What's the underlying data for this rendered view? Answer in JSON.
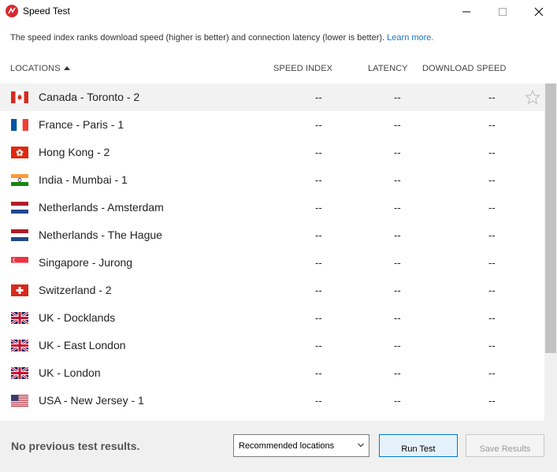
{
  "window": {
    "title": "Speed Test"
  },
  "info": {
    "text": "The speed index ranks download speed (higher is better) and connection latency (lower is better).",
    "link": "Learn more."
  },
  "columns": {
    "locations": "LOCATIONS",
    "speed_index": "SPEED INDEX",
    "latency": "LATENCY",
    "download_speed": "DOWNLOAD SPEED"
  },
  "rows": [
    {
      "location": "Canada - Toronto - 2",
      "flag": "canada-flag-icon",
      "speed_index": "--",
      "latency": "--",
      "download_speed": "--",
      "selected": true
    },
    {
      "location": "France - Paris - 1",
      "flag": "france-flag-icon",
      "speed_index": "--",
      "latency": "--",
      "download_speed": "--"
    },
    {
      "location": "Hong Kong - 2",
      "flag": "hong-kong-flag-icon",
      "speed_index": "--",
      "latency": "--",
      "download_speed": "--"
    },
    {
      "location": "India - Mumbai - 1",
      "flag": "india-flag-icon",
      "speed_index": "--",
      "latency": "--",
      "download_speed": "--"
    },
    {
      "location": "Netherlands - Amsterdam",
      "flag": "netherlands-flag-icon",
      "speed_index": "--",
      "latency": "--",
      "download_speed": "--"
    },
    {
      "location": "Netherlands - The Hague",
      "flag": "netherlands-flag-icon",
      "speed_index": "--",
      "latency": "--",
      "download_speed": "--"
    },
    {
      "location": "Singapore - Jurong",
      "flag": "singapore-flag-icon",
      "speed_index": "--",
      "latency": "--",
      "download_speed": "--"
    },
    {
      "location": "Switzerland - 2",
      "flag": "switzerland-flag-icon",
      "speed_index": "--",
      "latency": "--",
      "download_speed": "--"
    },
    {
      "location": "UK - Docklands",
      "flag": "uk-flag-icon",
      "speed_index": "--",
      "latency": "--",
      "download_speed": "--"
    },
    {
      "location": "UK - East London",
      "flag": "uk-flag-icon",
      "speed_index": "--",
      "latency": "--",
      "download_speed": "--"
    },
    {
      "location": "UK - London",
      "flag": "uk-flag-icon",
      "speed_index": "--",
      "latency": "--",
      "download_speed": "--"
    },
    {
      "location": "USA - New Jersey - 1",
      "flag": "usa-flag-icon",
      "speed_index": "--",
      "latency": "--",
      "download_speed": "--"
    }
  ],
  "footer": {
    "status": "No previous test results.",
    "location_filter": "Recommended locations",
    "run_label": "Run Test",
    "save_label": "Save Results"
  },
  "colors": {
    "accent": "#0078d7",
    "link": "#1a73c7",
    "brand": "#d9282f"
  }
}
